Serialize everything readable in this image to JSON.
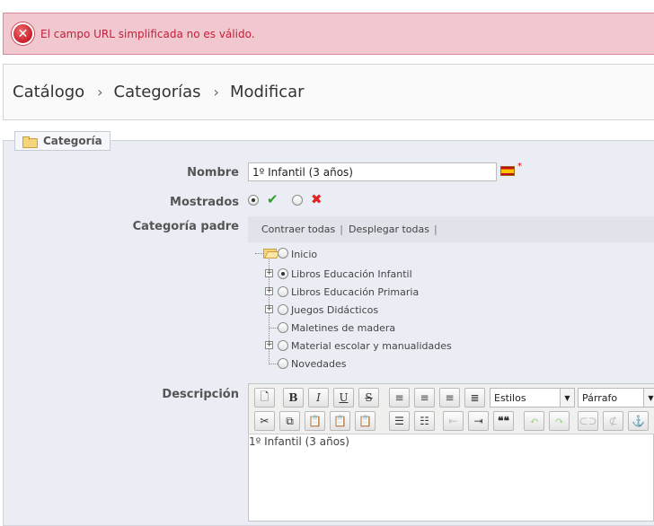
{
  "alert": {
    "icon": "error-x-icon",
    "message": "El campo URL simplificada no es válido."
  },
  "breadcrumb": {
    "items": [
      "Catálogo",
      "Categorías",
      "Modificar"
    ],
    "separator": "›"
  },
  "panel": {
    "legend": "Categoría",
    "legend_icon": "folder-icon"
  },
  "form": {
    "name_label": "Nombre",
    "name_value": "1º Infantil (3 años)",
    "required_marker": "*",
    "displayed_label": "Mostrados",
    "parent_label": "Categoría padre",
    "description_label": "Descripción"
  },
  "tree": {
    "collapse_all": "Contraer todas",
    "expand_all": "Desplegar todas",
    "pipe": "|",
    "root": "Inicio",
    "items": [
      {
        "label": "Libros Educación Infantil",
        "expandable": true,
        "selected": true
      },
      {
        "label": "Libros Educación Primaria",
        "expandable": true,
        "selected": false
      },
      {
        "label": "Juegos Didácticos",
        "expandable": true,
        "selected": false
      },
      {
        "label": "Maletines de madera",
        "expandable": false,
        "selected": false
      },
      {
        "label": "Material escolar y manualidades",
        "expandable": true,
        "selected": false
      },
      {
        "label": "Novedades",
        "expandable": false,
        "selected": false
      }
    ]
  },
  "editor": {
    "styles_select": "Estilos",
    "format_select": "Párrafo",
    "content": "1º Infantil (3 años)",
    "toolbar": {
      "bold": "B",
      "italic": "I",
      "underline": "U",
      "strike": "S",
      "quote": "❝❝"
    }
  },
  "colors": {
    "alert_bg": "#f2c8d0",
    "alert_text": "#c41e3a",
    "panel_bg": "#ebedf4"
  }
}
